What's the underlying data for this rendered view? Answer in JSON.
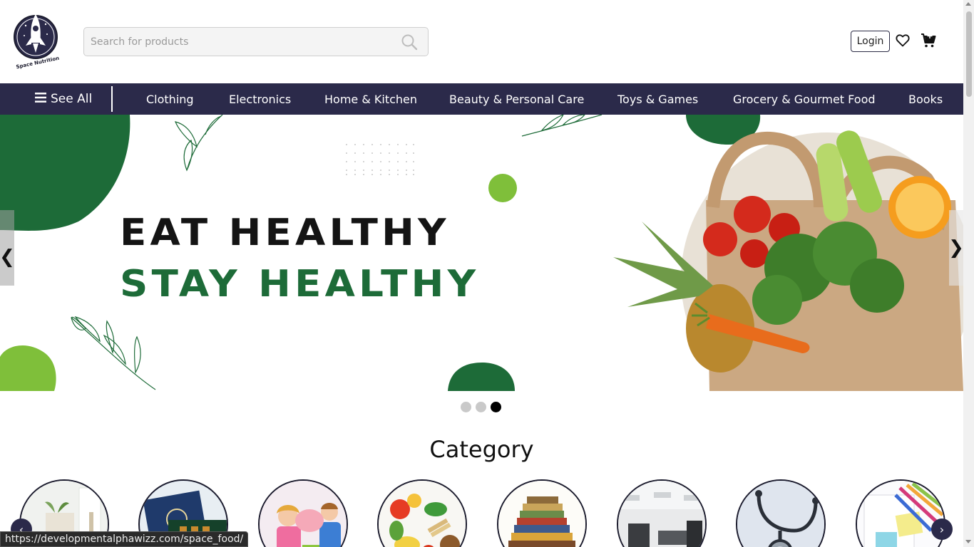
{
  "header": {
    "logo_text": "Space Nutrition",
    "search_placeholder": "Search for products",
    "login_label": "Login"
  },
  "icons": {
    "search": "search-icon",
    "wishlist": "heart-icon",
    "cart": "cart-icon",
    "menu": "hamburger-icon"
  },
  "nav": {
    "see_all": "See All",
    "items": [
      "Clothing",
      "Electronics",
      "Home & Kitchen",
      "Beauty & Personal Care",
      "Toys & Games",
      "Grocery & Gourmet Food",
      "Books"
    ]
  },
  "hero": {
    "line1": "EAT HEALTHY",
    "line2": "STAY HEALTHY",
    "prev": "❮",
    "next": "❯",
    "slide_count": 3,
    "active_slide": 3
  },
  "category": {
    "title": "Category",
    "items": [
      "home-decor",
      "gift-boxes",
      "toys",
      "vegetables",
      "books",
      "gym",
      "medical",
      "stationery"
    ],
    "prev": "‹",
    "next": "›"
  },
  "status": {
    "url": "https://developmentalphawizz.com/space_food/"
  },
  "colors": {
    "nav_bg": "#2b2a4a",
    "brand_green": "#1d6b38",
    "light_green": "#7fbf3a"
  }
}
